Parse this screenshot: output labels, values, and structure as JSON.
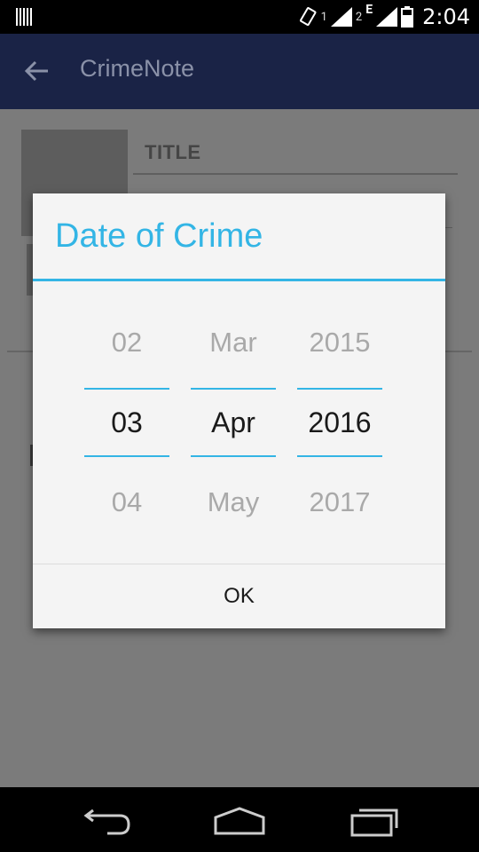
{
  "status_bar": {
    "sim1": "1",
    "sim2": "2",
    "network": "E",
    "time": "2:04"
  },
  "app_bar": {
    "title": "CrimeNote",
    "back_icon": "arrow-left-icon"
  },
  "form": {
    "title_label": "TITLE"
  },
  "dialog": {
    "title": "Date of Crime",
    "day": {
      "prev": "02",
      "current": "03",
      "next": "04"
    },
    "month": {
      "prev": "Mar",
      "current": "Apr",
      "next": "May"
    },
    "year": {
      "prev": "2015",
      "current": "2016",
      "next": "2017"
    },
    "ok_label": "OK"
  },
  "colors": {
    "accent": "#33b5e5",
    "app_bar": "#1a2346",
    "scrim": "#7b7b7b"
  }
}
